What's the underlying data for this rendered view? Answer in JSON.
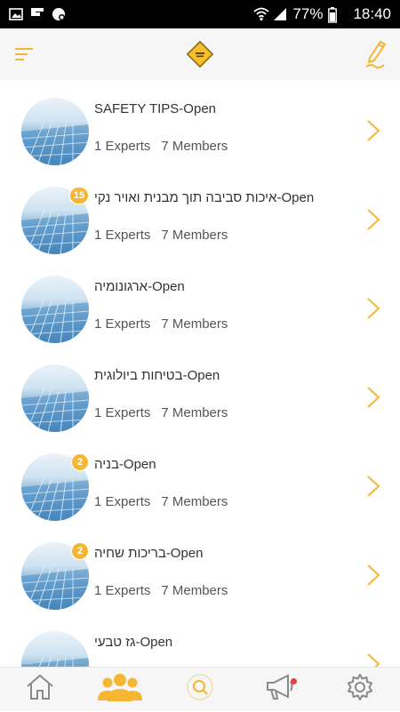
{
  "status_bar": {
    "battery": "77%",
    "time": "18:40",
    "icons": [
      "image-icon",
      "flipboard-icon",
      "chat-icon",
      "wifi-icon",
      "signal-icon",
      "battery-icon"
    ]
  },
  "top_bar": {
    "menu_icon": "menu-icon",
    "logo_icon": "caution-sign-logo",
    "edit_icon": "pencil-icon"
  },
  "groups": [
    {
      "title": "SAFETY TIPS-Open",
      "experts": "1 Experts",
      "members": "7 Members",
      "badge": ""
    },
    {
      "title": "איכות סביבה תוך מבנית ואויר נקי-Open",
      "experts": "1 Experts",
      "members": "7 Members",
      "badge": "15"
    },
    {
      "title": "ארגונומיה-Open",
      "experts": "1 Experts",
      "members": "7 Members",
      "badge": ""
    },
    {
      "title": "בטיחות ביולוגית-Open",
      "experts": "1 Experts",
      "members": "7 Members",
      "badge": ""
    },
    {
      "title": "בניה-Open",
      "experts": "1 Experts",
      "members": "7 Members",
      "badge": "2"
    },
    {
      "title": "בריכות שחיה-Open",
      "experts": "1 Experts",
      "members": "7 Members",
      "badge": "2"
    },
    {
      "title": "גז טבעי-Open",
      "experts": "",
      "members": "",
      "badge": ""
    }
  ],
  "bottom_nav": [
    "home-icon",
    "groups-icon",
    "search-icon",
    "megaphone-icon",
    "settings-icon"
  ],
  "colors": {
    "accent": "#f5b733",
    "statusbar": "#000000",
    "bar_bg": "#f6f6f6"
  }
}
